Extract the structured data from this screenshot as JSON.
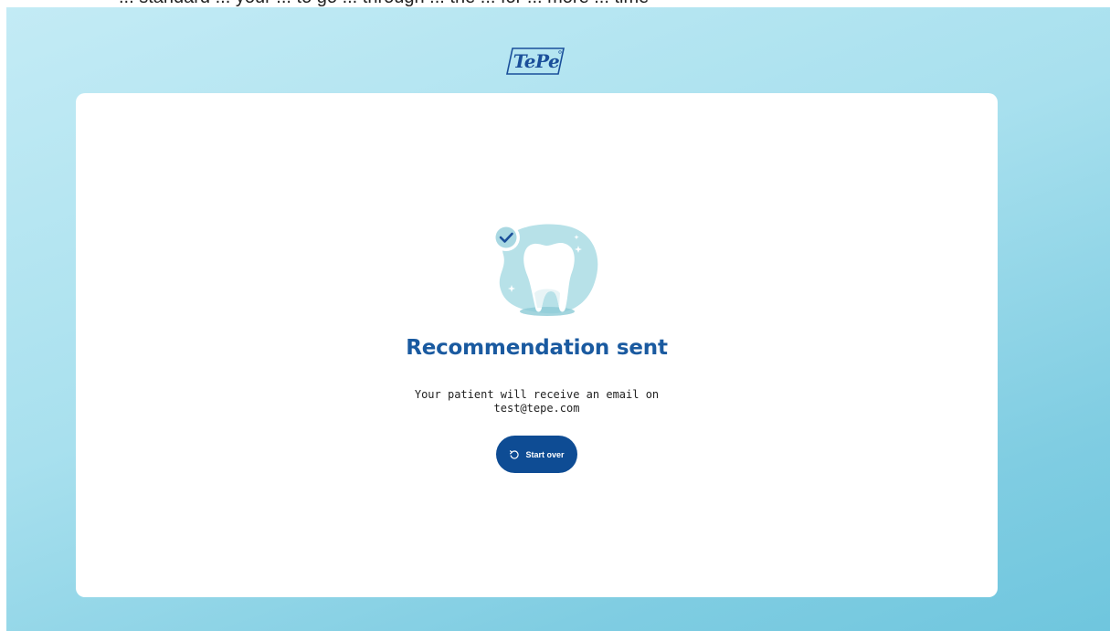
{
  "top_strip": {
    "text": "... standard ... your ... to go ... through ... the ... for ... more ... time"
  },
  "brand": {
    "logo_text": "TePe",
    "logo_color": "#1a4f9a"
  },
  "confirmation": {
    "illustration_icon": "tooth-check-icon",
    "heading": "Recommendation sent",
    "message_line1": "Your patient will receive an email on",
    "email": "test@tepe.com"
  },
  "actions": {
    "start_over_label": "Start over",
    "start_over_icon": "restart-icon",
    "button_color": "#0e4c94"
  },
  "colors": {
    "heading": "#1a5aa0",
    "background_gradient_start": "#c3ebf5",
    "background_gradient_end": "#6fc6de"
  }
}
